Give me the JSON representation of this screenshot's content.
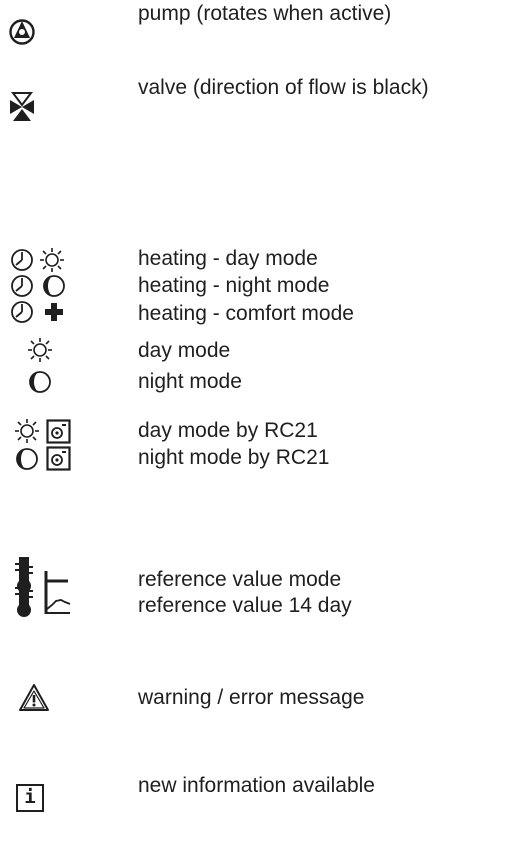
{
  "legend": {
    "pump": "pump (rotates when active)",
    "valve": "valve (direction of flow is black)",
    "heating_day": "heating - day mode",
    "heating_night": "heating - night mode",
    "heating_comfort": "heating - comfort mode",
    "day_mode": "day mode",
    "night_mode": "night mode",
    "day_mode_rc21": "day mode by RC21",
    "night_mode_rc21": "night mode by RC21",
    "reference_value_mode": "reference value mode",
    "reference_value_14_day": "reference value 14 day",
    "warning_error": "warning / error message",
    "new_information": "new information available"
  },
  "icons": {
    "info_glyph": "i"
  },
  "colors": {
    "ink": "#1f1f1f",
    "background": "#ffffff"
  }
}
